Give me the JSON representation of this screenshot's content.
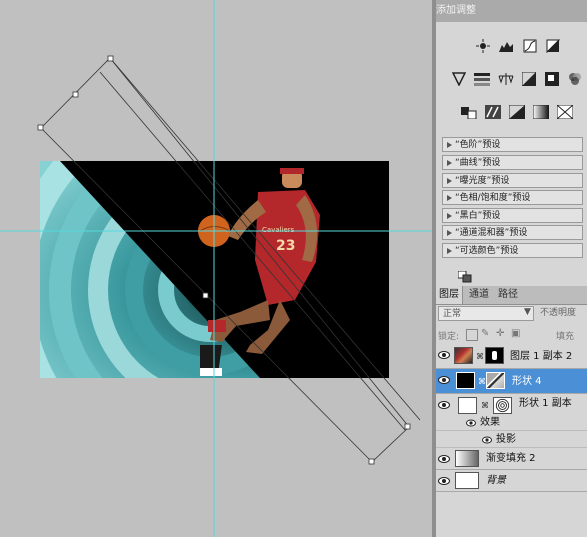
{
  "adjustments": {
    "title": "添加调整",
    "presets": [
      "“色阶”预设",
      "“曲线”预设",
      "“曝光度”预设",
      "“色相/饱和度”预设",
      "“黑白”预设",
      "“通道混和器”预设",
      "“可选颜色”预设"
    ]
  },
  "layers": {
    "tabs": [
      "图层",
      "通道",
      "路径"
    ],
    "blend_mode": "正常",
    "opacity_label": "不透明度",
    "lock_label": "锁定:",
    "fill_label": "填充",
    "items": [
      {
        "name": "图层 1 副本 2"
      },
      {
        "name": "形状 4"
      },
      {
        "name": "形状 1 副本"
      },
      {
        "name": "效果"
      },
      {
        "name": "投影"
      },
      {
        "name": "渐变填充 2"
      },
      {
        "name": "背景"
      }
    ]
  },
  "artwork": {
    "jersey_text": "23",
    "team_text": "Cavaliers"
  },
  "colors": {
    "selection": "#4b8fd6",
    "guides": "#56d9dc",
    "teal": "#59b9bd"
  }
}
